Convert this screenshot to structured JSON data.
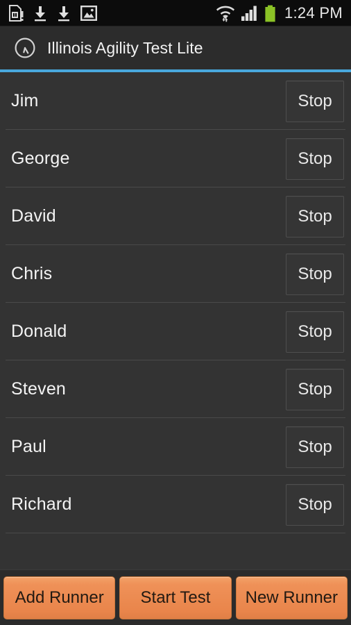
{
  "statusbar": {
    "time": "1:24 PM",
    "left_icons": [
      {
        "name": "sim-card-alert-icon",
        "label": "sim-card-alert"
      },
      {
        "name": "download-icon",
        "label": "download"
      },
      {
        "name": "download-icon-2",
        "label": "download"
      },
      {
        "name": "image-icon",
        "label": "image"
      }
    ],
    "right_icons": [
      {
        "name": "wifi-icon",
        "label": "wifi"
      },
      {
        "name": "cellular-signal-icon",
        "label": "cellular-signal"
      },
      {
        "name": "battery-icon",
        "label": "battery"
      }
    ],
    "battery_color": "#8bc226",
    "background_color": "#0c0c0c"
  },
  "actionbar": {
    "icon": "clock-icon",
    "title": "Illinois Agility Test Lite",
    "accent_color": "#49a8dd",
    "background_color": "#2c2c2c"
  },
  "list": {
    "stop_label": "Stop",
    "rows": [
      {
        "name": "Jim",
        "button": "Stop"
      },
      {
        "name": "George",
        "button": "Stop"
      },
      {
        "name": "David",
        "button": "Stop"
      },
      {
        "name": "Chris",
        "button": "Stop"
      },
      {
        "name": "Donald",
        "button": "Stop"
      },
      {
        "name": "Steven",
        "button": "Stop"
      },
      {
        "name": "Paul",
        "button": "Stop"
      },
      {
        "name": "Richard",
        "button": "Stop"
      }
    ]
  },
  "bottombar": {
    "buttons": [
      {
        "label": "Add Runner",
        "name": "add-runner-button"
      },
      {
        "label": "Start Test",
        "name": "start-test-button"
      },
      {
        "label": "New Runner",
        "name": "new-runner-button"
      }
    ],
    "button_color": "#ef9158",
    "background_color": "#2b2b2b"
  }
}
